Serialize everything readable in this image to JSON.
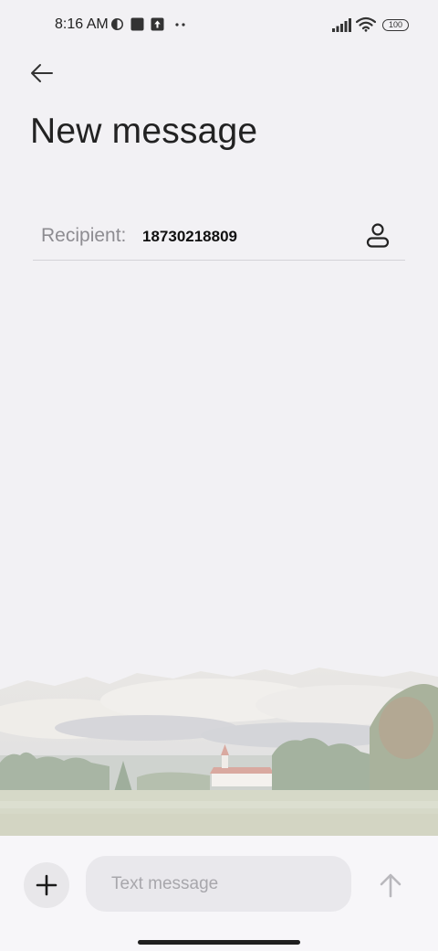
{
  "status_bar": {
    "time": "8:16 AM",
    "icons": [
      "clock-dnd-icon",
      "square-notification-icon",
      "upload-icon",
      "more-dots-icon",
      "signal-icon",
      "wifi-icon"
    ],
    "battery": "100"
  },
  "header": {
    "back_icon": "arrow-left-icon",
    "title": "New message"
  },
  "recipient": {
    "label": "Recipient:",
    "value": "18730218809",
    "contact_icon": "contact-person-icon"
  },
  "composer": {
    "add_icon": "plus-icon",
    "placeholder": "Text message",
    "send_icon": "arrow-up-icon"
  },
  "colors": {
    "background": "#f2f1f4",
    "input_bg": "#e9e8ec",
    "muted_text": "#8d8c91",
    "send_disabled": "#b9b8bd"
  }
}
